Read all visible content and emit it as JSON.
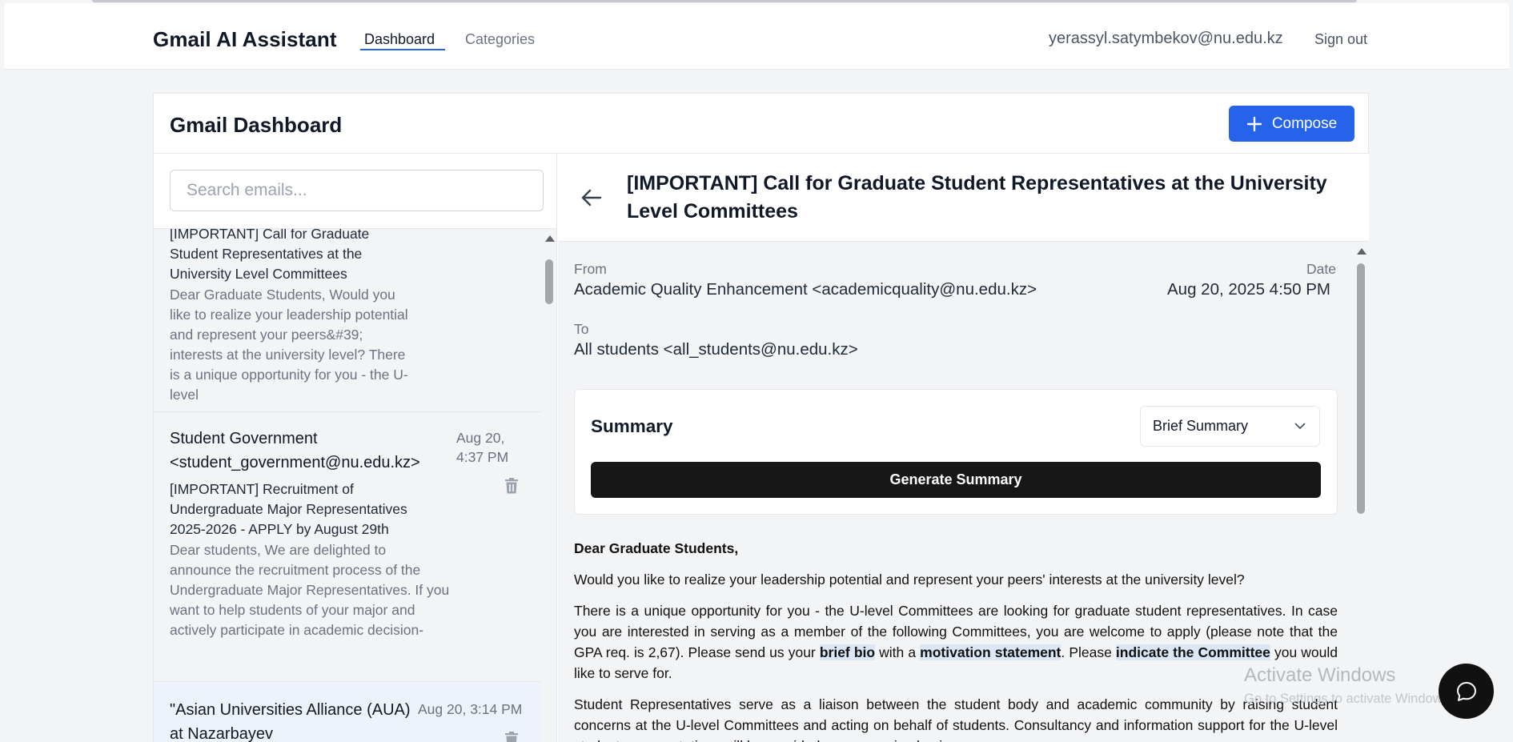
{
  "header": {
    "brand": "Gmail AI Assistant",
    "nav": [
      {
        "label": "Dashboard",
        "active": true
      },
      {
        "label": "Categories",
        "active": false
      }
    ],
    "user_email": "yerassyl.satymbekov@nu.edu.kz",
    "signout_label": "Sign out",
    "accent_color": "#2563eb"
  },
  "dashboard": {
    "title": "Gmail Dashboard",
    "compose_label": "Compose",
    "compose_icon": "plus-icon"
  },
  "search": {
    "placeholder": "Search emails...",
    "value": ""
  },
  "email_list": [
    {
      "subject": "[IMPORTANT] Call for Graduate Student Representatives at the University Level Committees",
      "snippet": "Dear Graduate Students, Would you like to realize your leadership potential and represent your peers&#39; interests at the university level? There is a unique opportunity for you - the U-level"
    },
    {
      "sender": "Student Government <student_government@nu.edu.kz>",
      "date": "Aug 20, 4:37 PM",
      "subject": "[IMPORTANT] Recruitment of Undergraduate Major Representatives 2025-2026 - APPLY by August 29th",
      "snippet": "Dear students, We are delighted to announce the recruitment process of the Undergraduate Major Representatives. If you want to help students of your major and actively participate in academic decision-"
    },
    {
      "sender": "\"Asian Universities Alliance (AUA) at Nazarbayev",
      "date": "Aug 20, 3:14 PM"
    }
  ],
  "detail": {
    "subject": "[IMPORTANT] Call for Graduate Student Representatives at the University Level Committees",
    "from_label": "From",
    "from_value": "Academic Quality Enhancement <academicquality@nu.edu.kz>",
    "date_label": "Date",
    "date_value": "Aug 20, 2025 4:50 PM",
    "to_label": "To",
    "to_value": "All students <all_students@nu.edu.kz>",
    "summary": {
      "title": "Summary",
      "mode": "Brief Summary",
      "generate_label": "Generate Summary"
    },
    "body": {
      "greeting": "Dear Graduate Students,",
      "p1": "Would you like to realize your leadership potential and represent your peers' interests at the university level?",
      "p2_a": "There is a unique opportunity for you - the U-level Committees are looking for graduate student representatives. In case you are interested in serving as a member of the following Committees, you are welcome to apply (please note that the GPA req. is 2,67). Please send us your ",
      "p2_hl1": "brief bio",
      "p2_b": " with a ",
      "p2_hl2": "motivation statement",
      "p2_c": ". Please ",
      "p2_hl3": "indicate the Committee",
      "p2_d": " you would like to serve for.",
      "p3": "Student Representatives serve as a liaison between the student body and academic community by raising student concerns at the U-level Committees and acting on behalf of students. Consultancy and information support for the U-level student representatives will be provided on an ongoing basis."
    }
  },
  "watermark": {
    "title": "Activate Windows",
    "subtitle": "Go to Settings to activate Windows."
  },
  "chat_icon": "chat-bubble-icon"
}
